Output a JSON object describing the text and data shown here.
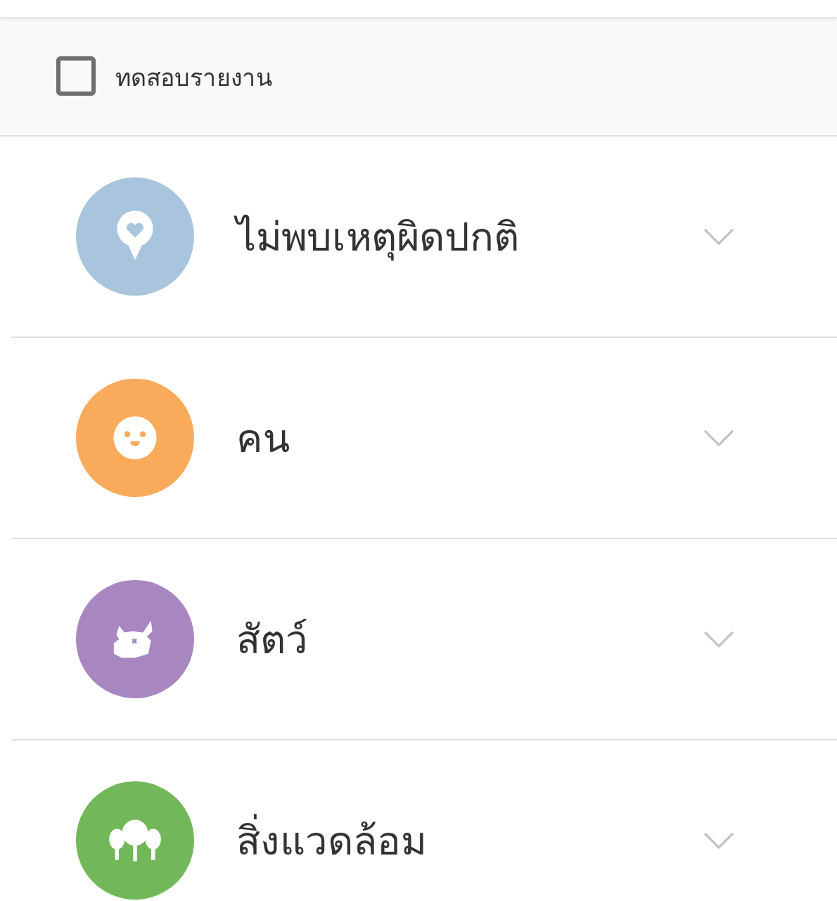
{
  "report_test": {
    "label": "ทดสอบรายงาน",
    "checked": false
  },
  "categories": [
    {
      "kind": "pin",
      "label": "ไม่พบเหตุผิดปกติ",
      "color": "#a9c5dd"
    },
    {
      "kind": "face",
      "label": "คน",
      "color": "#f9aa5b"
    },
    {
      "kind": "animal",
      "label": "สัตว์",
      "color": "#a886c0"
    },
    {
      "kind": "trees",
      "label": "สิ่งแวดล้อม",
      "color": "#72b85a"
    }
  ]
}
